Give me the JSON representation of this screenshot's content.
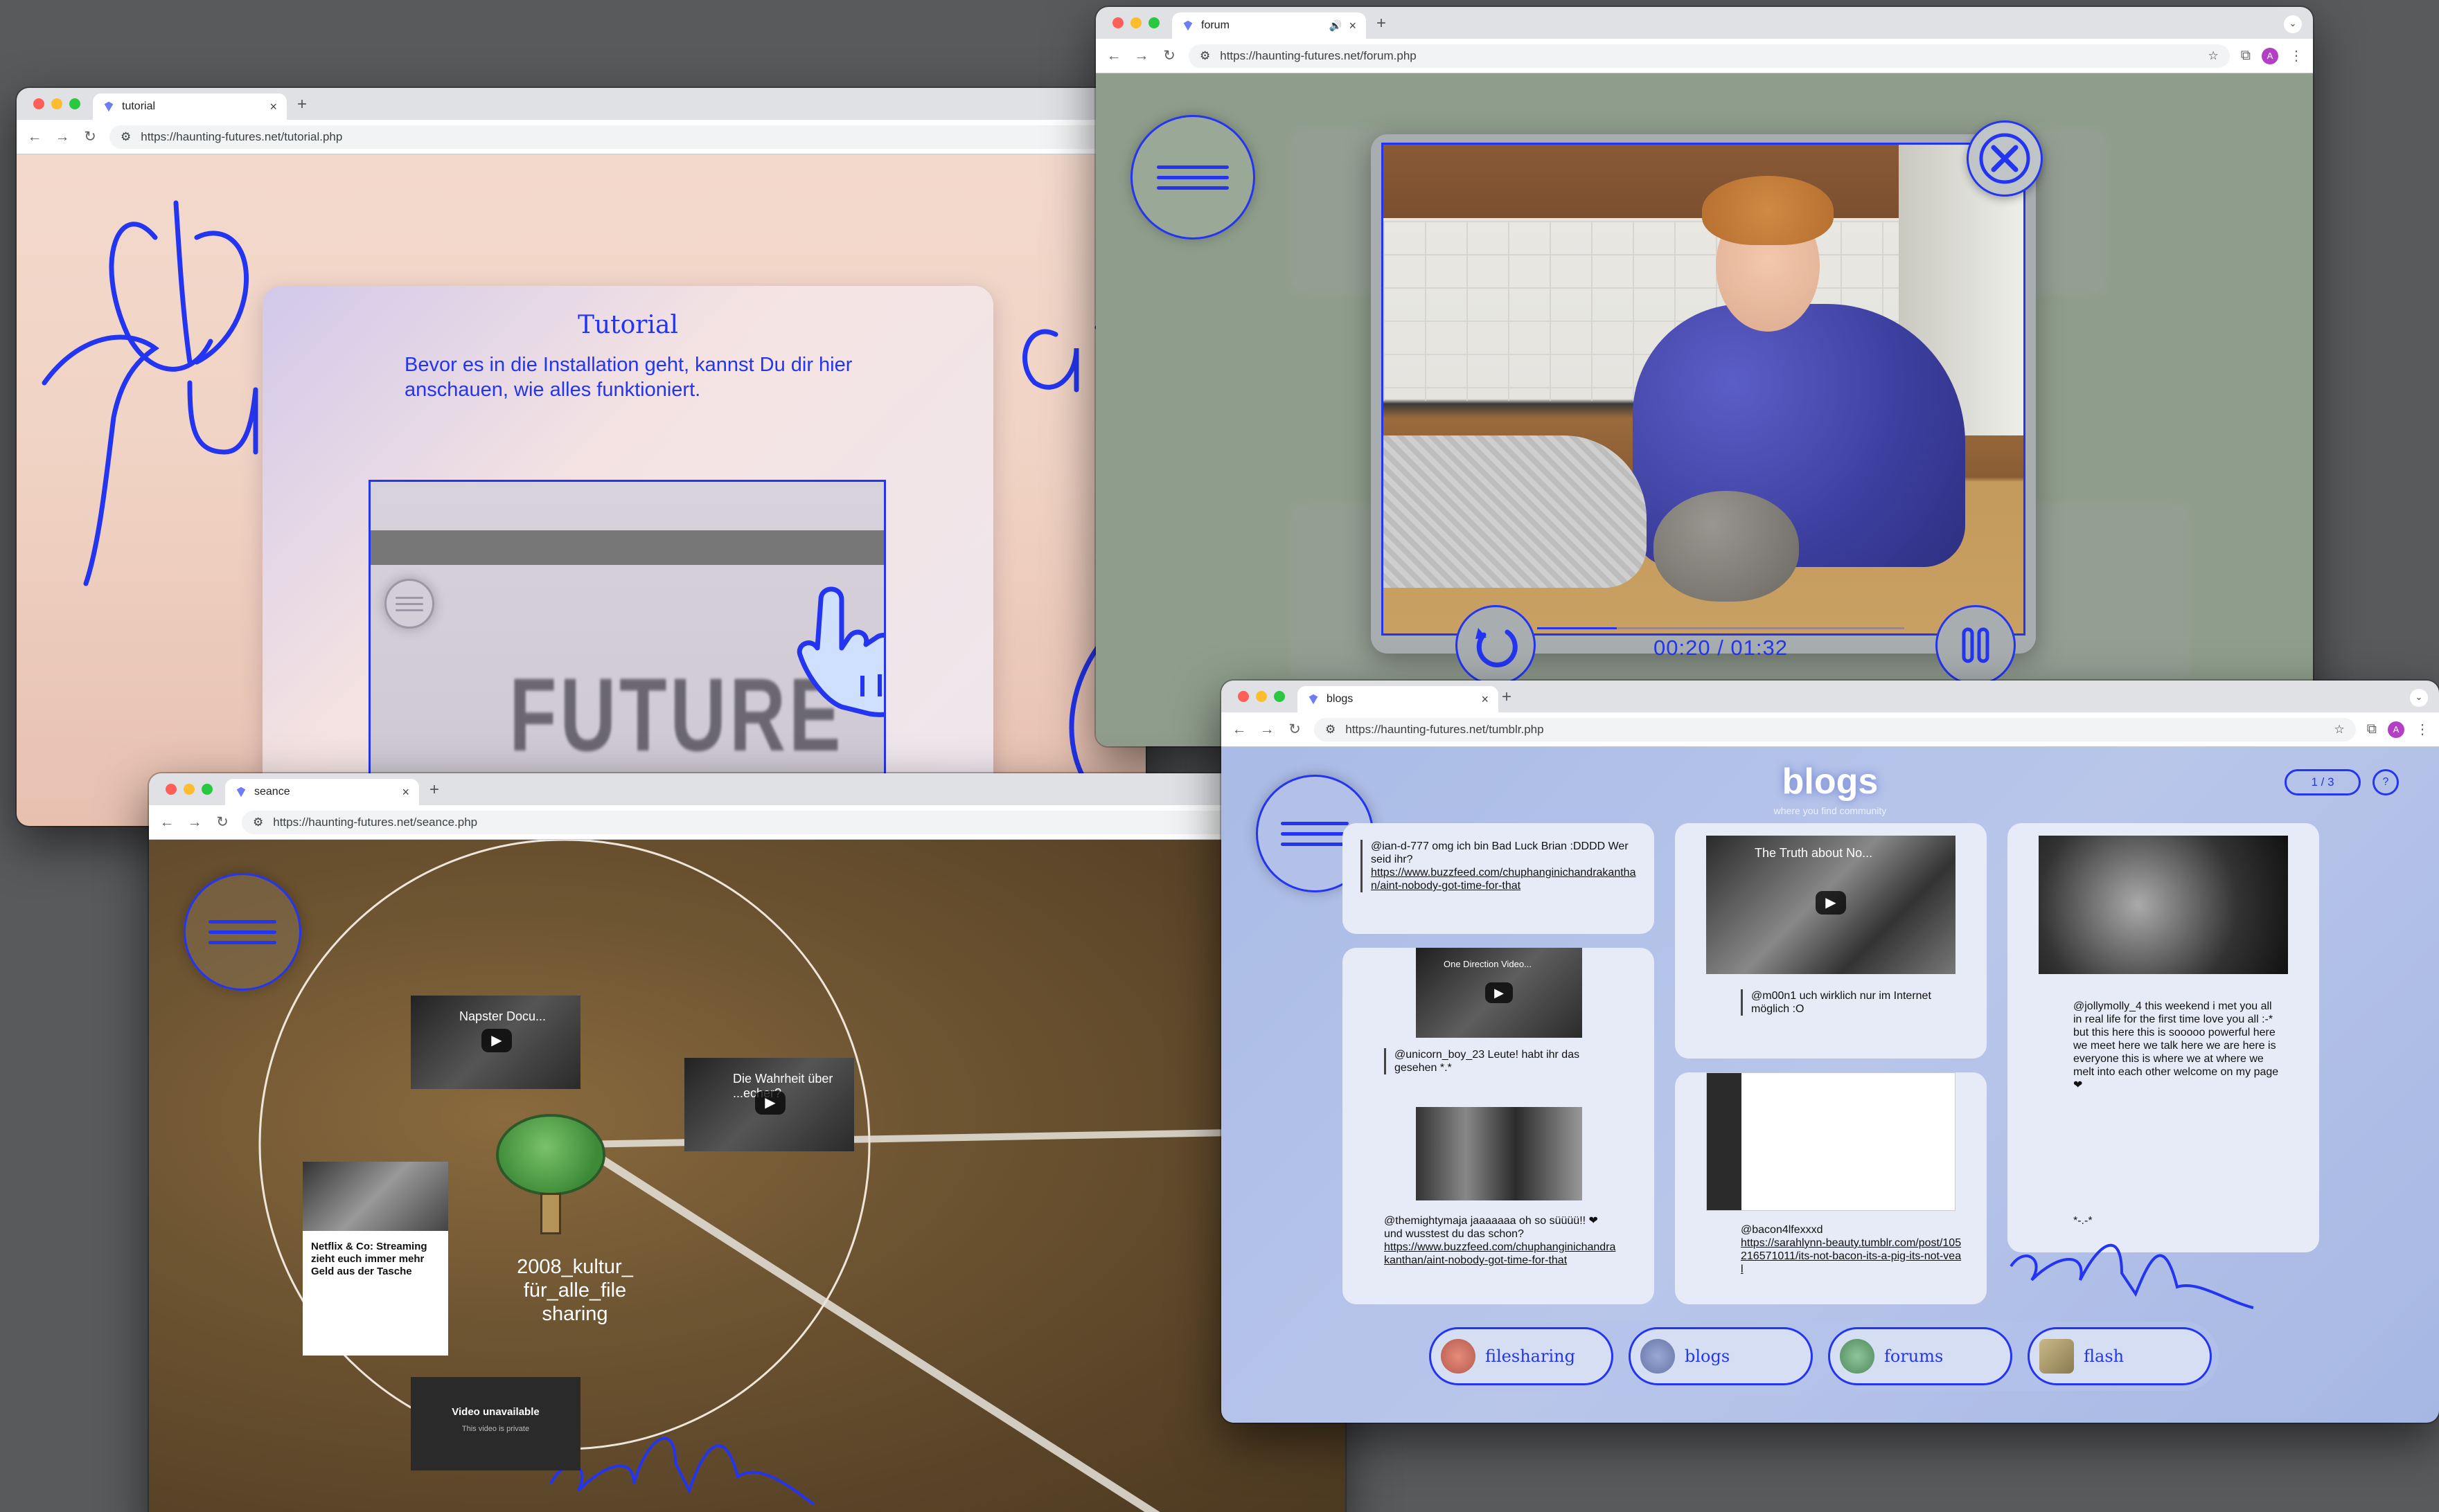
{
  "tutorial": {
    "tab_title": "tutorial",
    "url": "https://haunting-futures.net/tutorial.php",
    "panel_title": "Tutorial",
    "panel_text": "Bevor es in die Installation geht, kannst Du dir hier anschauen, wie alles funktioniert.",
    "preview_word": "FUTURE"
  },
  "forum": {
    "tab_title": "forum",
    "url": "https://haunting-futures.net/forum.php",
    "video_time": "00:20 / 01:32",
    "video_progress": 0.217
  },
  "seance": {
    "tab_title": "seance",
    "url": "https://haunting-futures.net/seance.php",
    "node_label": "2008_kultur_ für_alle_file sharing",
    "video1_title": "Napster Docu...",
    "video2_title": "Die Wahrheit über ...echer?",
    "article_title": "Netflix & Co: Streaming zieht euch immer mehr Geld aus der Tasche",
    "unavailable_title": "Video unavailable",
    "unavailable_sub": "This video is private"
  },
  "blogs": {
    "tab_title": "blogs",
    "url": "https://haunting-futures.net/tumblr.php",
    "heading": "blogs",
    "subheading": "where you find community",
    "pager": "1 / 3",
    "help": "?",
    "posts": {
      "p1_text": "@ian-d-777 omg ich bin Bad Luck Brian :DDDD Wer seid ihr?",
      "p1_link": "https://www.buzzfeed.com/chuphanginichandrakanthan/aint-nobody-got-time-for-that",
      "p2_video": "One Direction Video...",
      "p2_text": "@unicorn_boy_23 Leute! habt ihr das gesehen *.*",
      "p2_text2": "@themightymaja jaaaaaaa oh so süüüü!! ❤ und wusstest du das schon?",
      "p2_link": "https://www.buzzfeed.com/chuphanginichandrakanthan/aint-nobody-got-time-for-that",
      "p3_video": "The Truth about No...",
      "p3_text": "@m00n1 uch wirklich nur im Internet möglich :O",
      "p4_text": "@bacon4lfexxxd",
      "p4_link": "https://sarahlynn-beauty.tumblr.com/post/105216571011/its-not-bacon-its-a-pig-its-not-veal",
      "p5_text": "@jollymolly_4 this weekend i met you all in real life for the first time love you all :-*  but this here this is sooooo powerful here we meet here we talk here we are here is everyone this is where we at where we melt into each other welcome on my page ❤",
      "p5_sign": "*-.-*"
    },
    "nav": [
      {
        "label": "filesharing"
      },
      {
        "label": "blogs"
      },
      {
        "label": "forums"
      },
      {
        "label": "flash"
      }
    ]
  }
}
